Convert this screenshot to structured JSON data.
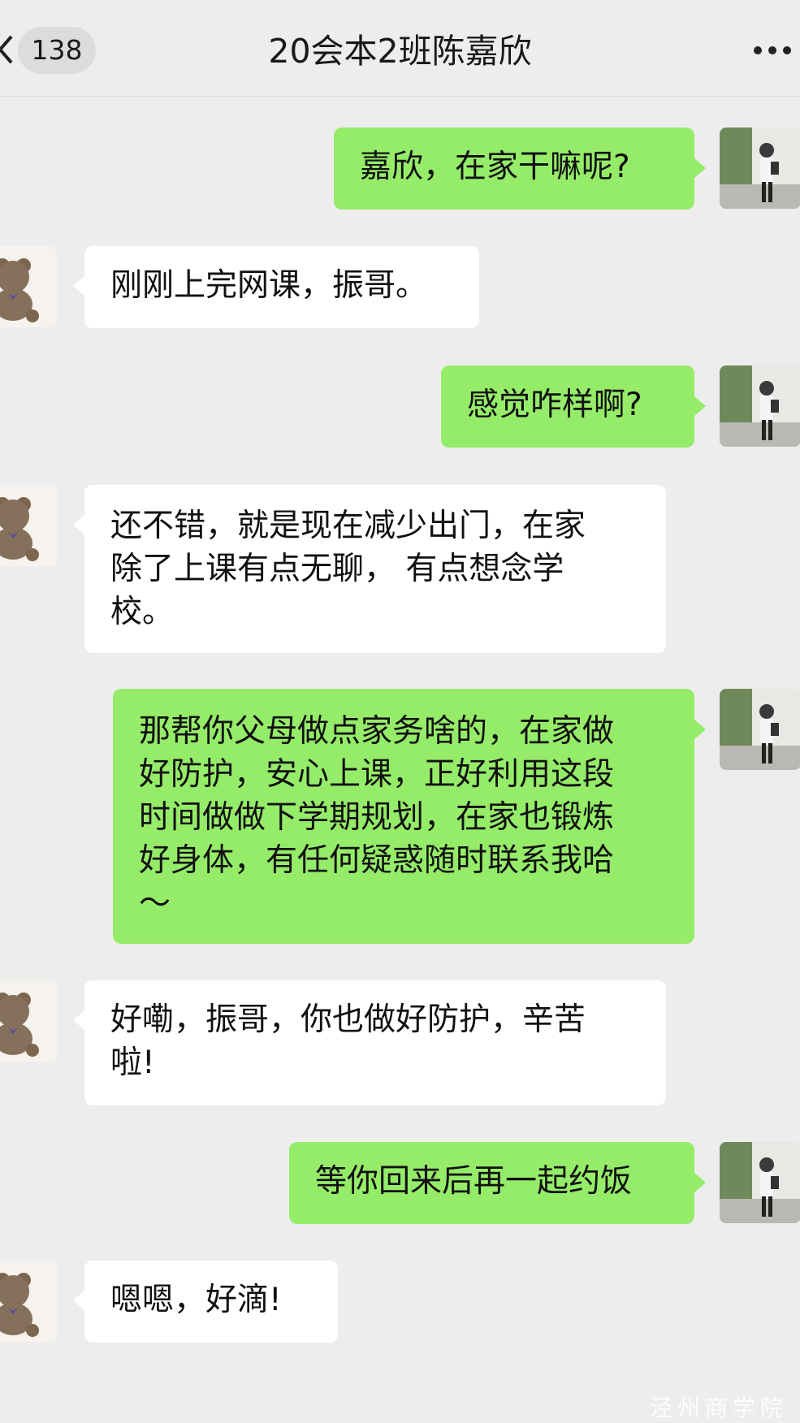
{
  "header": {
    "badge_count": "138",
    "title": "20会本2班陈嘉欣"
  },
  "messages": [
    {
      "from": "me",
      "text": "嘉欣，在家干嘛呢?"
    },
    {
      "from": "other",
      "text": "刚刚上完网课，振哥。"
    },
    {
      "from": "me",
      "text": "感觉咋样啊?"
    },
    {
      "from": "other",
      "text": "还不错，就是现在减少出门，在家\n除了上课有点无聊， 有点想念学\n校。"
    },
    {
      "from": "me",
      "text": "那帮你父母做点家务啥的，在家做\n好防护，安心上课，正好利用这段\n时间做做下学期规划，在家也锻炼\n好身体，有任何疑惑随时联系我哈\n～"
    },
    {
      "from": "other",
      "text": "好嘞，振哥，你也做好防护，辛苦\n啦!"
    },
    {
      "from": "me",
      "text": "等你回来后再一起约饭"
    },
    {
      "from": "other",
      "text": "嗯嗯，好滴!"
    }
  ],
  "icons": {
    "back": "chevron-left-icon",
    "more": "more-dots-icon",
    "my_avatar": "person-photo-avatar",
    "other_avatar": "teddy-bear-avatar"
  },
  "colors": {
    "my_bubble": "#95ec69",
    "other_bubble": "#ffffff",
    "background": "#ededed"
  },
  "watermark": "泾州商学院"
}
